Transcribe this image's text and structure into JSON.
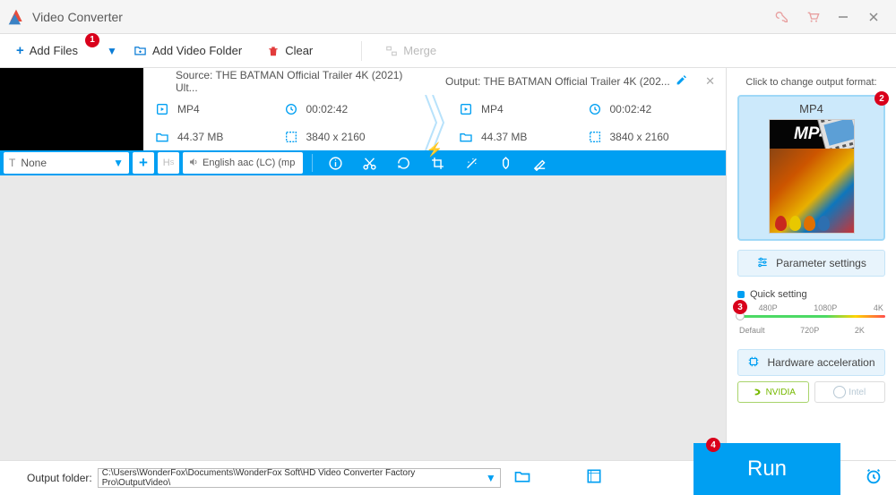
{
  "app_title": "Video Converter",
  "toolbar": {
    "add_files": "Add Files",
    "add_folder": "Add Video Folder",
    "clear": "Clear",
    "merge": "Merge"
  },
  "item": {
    "source_label": "Source: THE BATMAN Official Trailer 4K (2021) Ult...",
    "output_label": "Output: THE BATMAN Official Trailer 4K (202...",
    "src": {
      "format": "MP4",
      "duration": "00:02:42",
      "size": "44.37 MB",
      "resolution": "3840 x 2160"
    },
    "out": {
      "format": "MP4",
      "duration": "00:02:42",
      "size": "44.37 MB",
      "resolution": "3840 x 2160"
    }
  },
  "editbar": {
    "subtitle": "None",
    "h_label": "H",
    "audio": "English aac (LC) (mp"
  },
  "right": {
    "title": "Click to change output format:",
    "format": "MP4",
    "mp4_art": "MP4",
    "param": "Parameter settings",
    "quick": "Quick setting",
    "q": {
      "p480": "480P",
      "p720": "720P",
      "p1080": "1080P",
      "p2k": "2K",
      "p4k": "4K",
      "default": "Default"
    },
    "hw": "Hardware acceleration",
    "nvidia": "NVIDIA",
    "intel": "Intel"
  },
  "footer": {
    "label": "Output folder:",
    "path": "C:\\Users\\WonderFox\\Documents\\WonderFox Soft\\HD Video Converter Factory Pro\\OutputVideo\\",
    "run": "Run"
  },
  "badges": {
    "b1": "1",
    "b2": "2",
    "b3": "3",
    "b4": "4"
  }
}
